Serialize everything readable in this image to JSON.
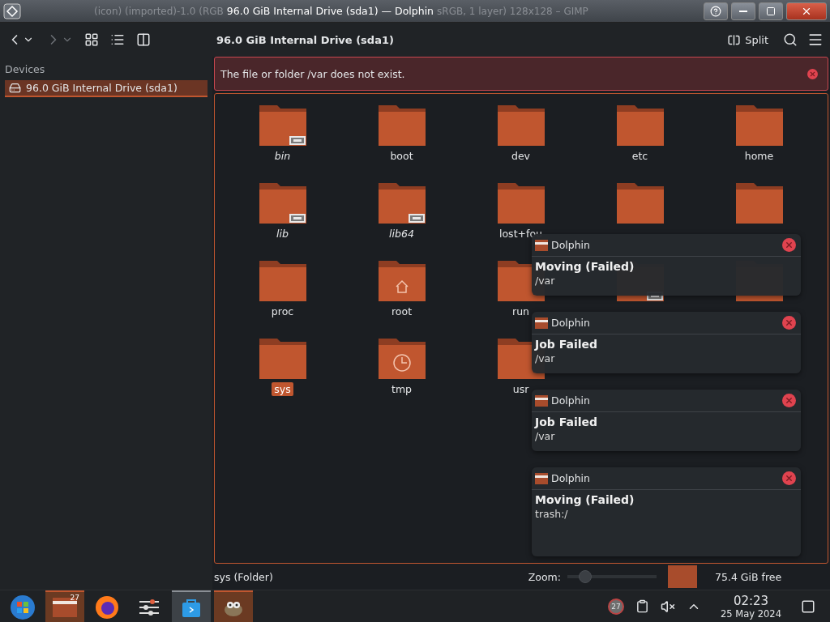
{
  "title_bar": {
    "background_left": "(icon) (imported)-1.0 (RGB",
    "title": "96.0 GiB Internal Drive (sda1) — Dolphin",
    "background_right": "sRGB, 1 layer) 128x128 – GIMP"
  },
  "toolbar": {
    "location": "96.0 GiB Internal Drive (sda1)",
    "split_label": "Split"
  },
  "sidebar": {
    "heading": "Devices",
    "items": [
      {
        "label": "96.0 GiB Internal Drive (sda1)",
        "selected": true
      }
    ]
  },
  "message": {
    "text": "The file or folder /var does not exist."
  },
  "folders": [
    {
      "label": "bin",
      "kind": "link",
      "selected": false
    },
    {
      "label": "boot",
      "kind": "plain",
      "selected": false
    },
    {
      "label": "dev",
      "kind": "plain",
      "selected": false
    },
    {
      "label": "etc",
      "kind": "plain",
      "selected": false
    },
    {
      "label": "home",
      "kind": "plain",
      "selected": false
    },
    {
      "label": "lib",
      "kind": "link",
      "selected": false
    },
    {
      "label": "lib64",
      "kind": "link",
      "selected": false
    },
    {
      "label": "lost+fou",
      "kind": "plain",
      "selected": false
    },
    {
      "kind": "plain"
    },
    {
      "kind": "plain"
    },
    {
      "label": "proc",
      "kind": "plain",
      "selected": false
    },
    {
      "label": "root",
      "kind": "home",
      "selected": false
    },
    {
      "label": "run",
      "kind": "plain",
      "selected": false
    },
    {
      "kind": "link"
    },
    {
      "kind": "plain"
    },
    {
      "label": "sys",
      "kind": "plain",
      "selected": true
    },
    {
      "label": "tmp",
      "kind": "clock",
      "selected": false
    },
    {
      "label": "usr",
      "kind": "plain",
      "selected": false
    }
  ],
  "notifications": [
    {
      "app": "Dolphin",
      "title": "Moving (Failed)",
      "body": "/var"
    },
    {
      "app": "Dolphin",
      "title": "Job Failed",
      "body": "/var"
    },
    {
      "app": "Dolphin",
      "title": "Job Failed",
      "body": "/var"
    },
    {
      "app": "Dolphin",
      "title": "Moving (Failed)",
      "body": "trash:/"
    }
  ],
  "status_bar": {
    "text": "sys (Folder)",
    "zoom_label": "Zoom:",
    "zoom": {
      "level": 0.2
    },
    "free_space": "75.4 GiB free"
  },
  "taskbar": {
    "tasks": [
      {
        "kind": "start",
        "open": false,
        "active": false
      },
      {
        "kind": "folder",
        "open": true,
        "active": false,
        "badge": "27"
      },
      {
        "kind": "browser",
        "open": false,
        "active": false
      },
      {
        "kind": "mixer",
        "open": false,
        "active": false
      },
      {
        "kind": "store",
        "open": false,
        "active": true
      },
      {
        "kind": "gimp",
        "open": true,
        "active": false
      }
    ],
    "tray_badge": "27",
    "time": "02:23",
    "date": "25 May 2024"
  }
}
